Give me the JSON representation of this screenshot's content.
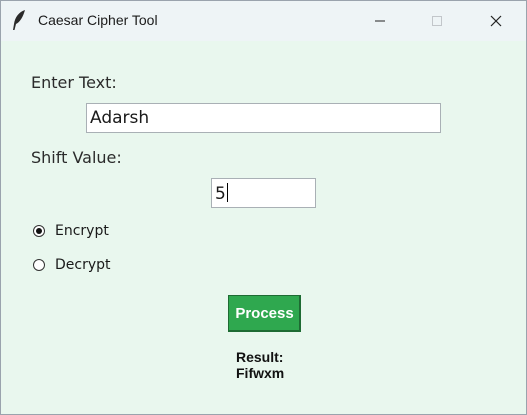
{
  "window": {
    "title": "Caesar Cipher Tool",
    "app_icon": "feather-icon",
    "controls": [
      "minimize-icon",
      "maximize-icon",
      "close-icon"
    ]
  },
  "form": {
    "text_label": "Enter Text:",
    "text_value": "Adarsh",
    "shift_label": "Shift Value:",
    "shift_value": "5",
    "mode_options": [
      {
        "label": "Encrypt",
        "checked": true
      },
      {
        "label": "Decrypt",
        "checked": false
      }
    ],
    "process_label": "Process"
  },
  "result": {
    "label": "Result:",
    "value": "Fifwxm"
  },
  "colors": {
    "background": "#e9f7ee",
    "titlebar": "#eef4f6",
    "button": "#2fa84f",
    "button_text": "#ffffff"
  }
}
